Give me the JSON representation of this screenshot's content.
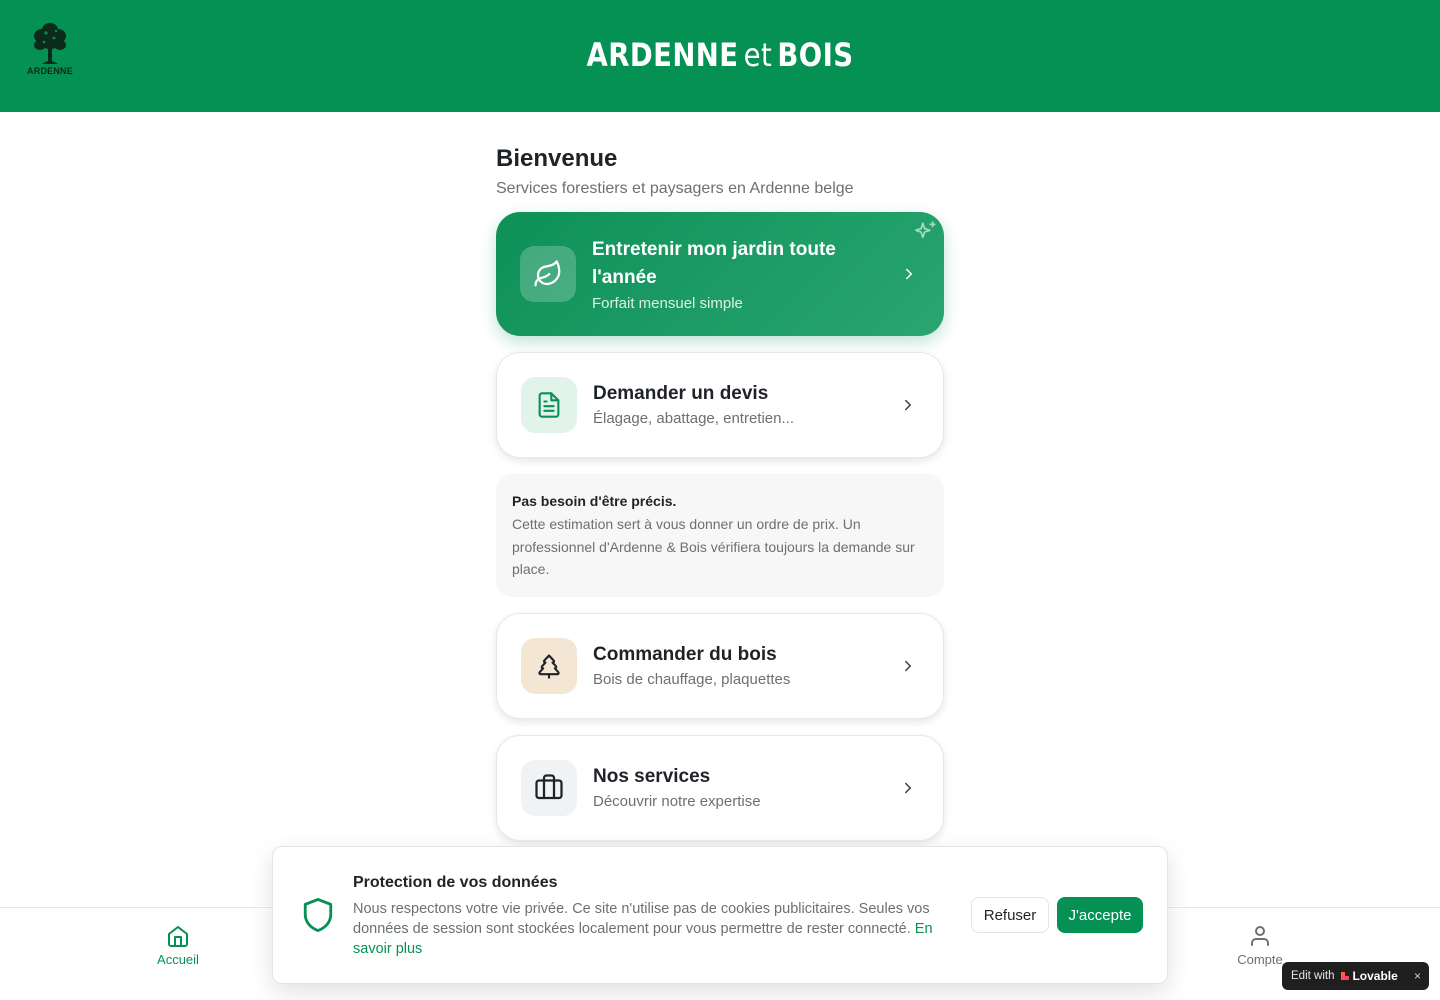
{
  "header": {
    "logo_text": "ARDENNE",
    "brand_part1": "ARDENNE",
    "brand_part2": "et",
    "brand_part3": "BOIS"
  },
  "main": {
    "title": "Bienvenue",
    "subtitle": "Services forestiers et paysagers en Ardenne belge",
    "featured": {
      "title": "Entretenir mon jardin toute l'année",
      "description": "Forfait mensuel simple",
      "icon": "leaf-icon"
    },
    "cards": [
      {
        "title": "Demander un devis",
        "description": "Élagage, abattage, entretien...",
        "icon": "document-icon"
      },
      {
        "title": "Commander du bois",
        "description": "Bois de chauffage, plaquettes",
        "icon": "tree-icon"
      },
      {
        "title": "Nos services",
        "description": "Découvrir notre expertise",
        "icon": "briefcase-icon"
      }
    ],
    "note": {
      "title": "Pas besoin d'être précis.",
      "body": "Cette estimation sert à vous donner un ordre de prix. Un professionnel d'Ardenne & Bois vérifiera toujours la demande sur place."
    }
  },
  "bottom_nav": {
    "home_label": "Accueil",
    "account_label": "Compte"
  },
  "cookie": {
    "title": "Protection de vos données",
    "body": "Nous respectons votre vie privée. Ce site n'utilise pas de cookies publicitaires. Seules vos données de session sont stockées localement pour vous permettre de rester connecté.",
    "link": "En savoir plus",
    "refuse_label": "Refuser",
    "accept_label": "J'accepte"
  },
  "badge": {
    "edit_with": "Edit with",
    "brand": "Lovable",
    "close": "×"
  },
  "colors": {
    "primary": "#059154",
    "text": "#1f2328",
    "muted": "#6b7075"
  }
}
